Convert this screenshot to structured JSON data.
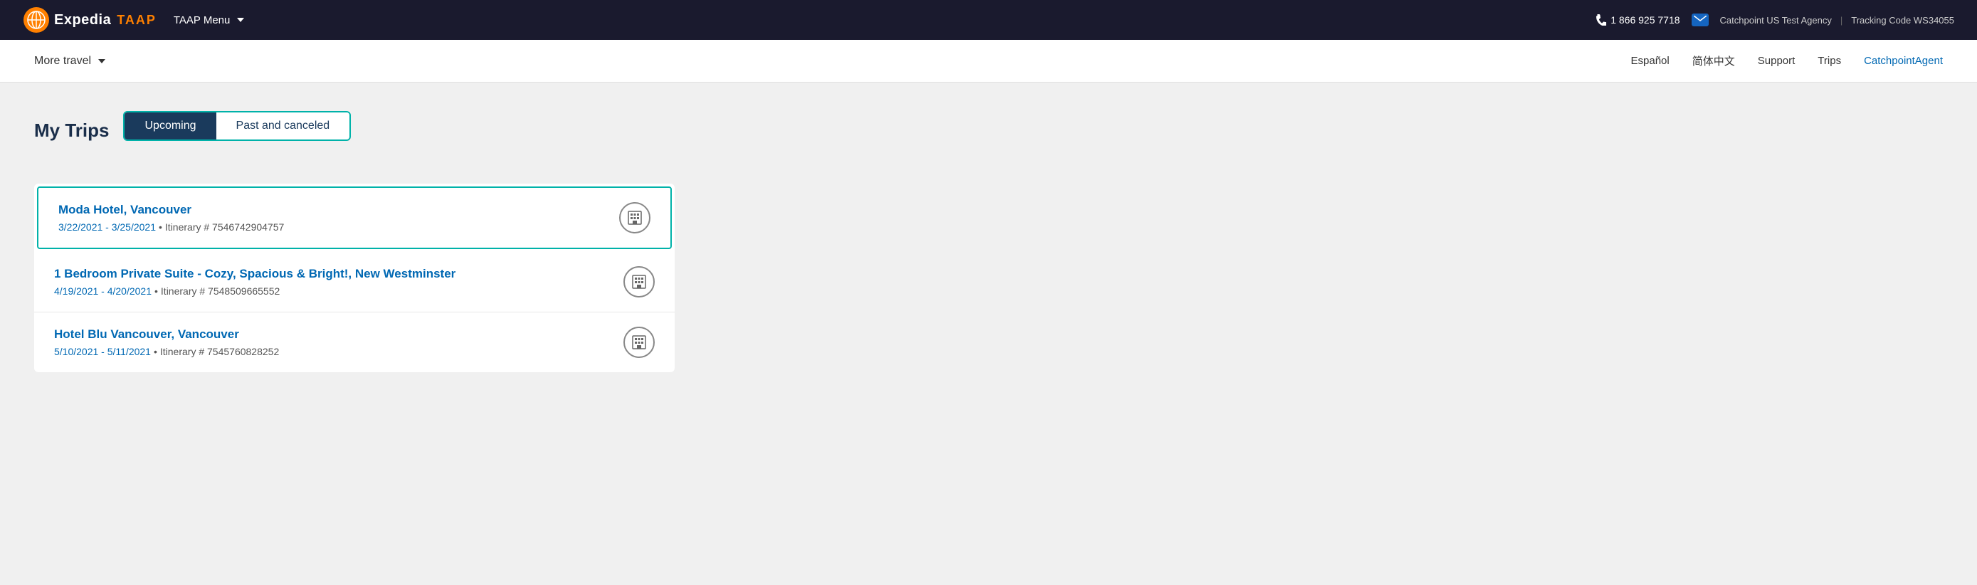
{
  "topbar": {
    "logo_text": "Expedia",
    "taap_label": "TAAP",
    "menu_label": "TAAP Menu",
    "phone_number": "1 866 925 7718",
    "agency_name": "Catchpoint US Test Agency",
    "tracking_label": "Tracking Code WS34055"
  },
  "secondary_nav": {
    "more_travel": "More travel",
    "lang1": "Español",
    "lang2": "简体中文",
    "support": "Support",
    "trips": "Trips",
    "agent": "CatchpointAgent"
  },
  "page": {
    "title": "My Trips",
    "tab_upcoming": "Upcoming",
    "tab_past": "Past and canceled"
  },
  "trips": [
    {
      "name": "Moda Hotel, Vancouver",
      "dates": "3/22/2021 - 3/25/2021",
      "itinerary": "Itinerary # 7546742904757",
      "active": true
    },
    {
      "name": "1 Bedroom Private Suite - Cozy, Spacious & Bright!, New Westminster",
      "dates": "4/19/2021 - 4/20/2021",
      "itinerary": "Itinerary # 7548509665552",
      "active": false
    },
    {
      "name": "Hotel Blu Vancouver, Vancouver",
      "dates": "5/10/2021 - 5/11/2021",
      "itinerary": "Itinerary # 7545760828252",
      "active": false
    }
  ]
}
